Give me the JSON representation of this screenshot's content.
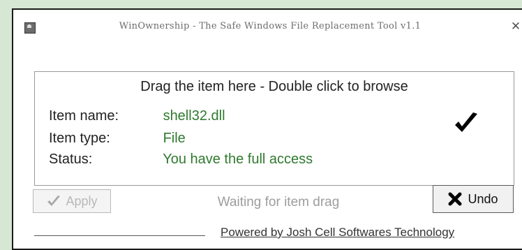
{
  "window": {
    "title": "WinOwnership - The Safe Windows File Replacement Tool v1.1",
    "close_glyph": "✕",
    "app_icon": "user-icon"
  },
  "dropzone": {
    "header": "Drag the item here - Double click to browse",
    "rows": [
      {
        "label": "Item name:",
        "value": "shell32.dll"
      },
      {
        "label": "Item type:",
        "value": "File"
      },
      {
        "label": "Status:",
        "value": "You have the full access"
      }
    ],
    "status_icon": "checkmark-icon"
  },
  "actions": {
    "apply_label": "Apply",
    "apply_icon": "checkmark-icon",
    "status": "Waiting for item drag",
    "undo_label": "Undo",
    "undo_icon": "x-icon"
  },
  "footer": {
    "powered_by": "Powered by Josh Cell Softwares Technology"
  },
  "colors": {
    "value_green": "#2f7a2f",
    "background": "#d6e8d4"
  }
}
